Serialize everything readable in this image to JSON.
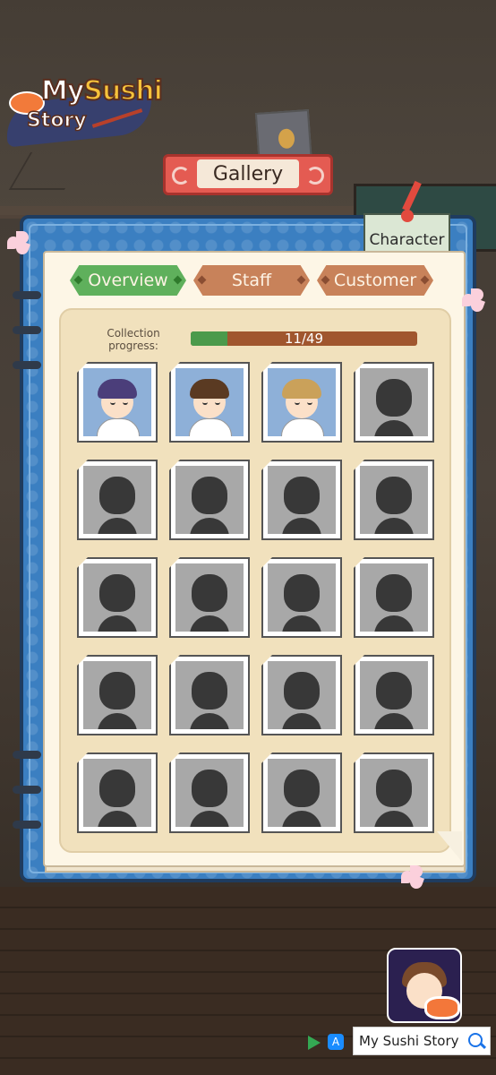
{
  "logo": {
    "line1_a": "My",
    "line1_b": "Sushi",
    "line2": "Story"
  },
  "header": {
    "title": "Gallery"
  },
  "book": {
    "tag_label": "Character"
  },
  "tabs": [
    {
      "label": "Overview",
      "active": true
    },
    {
      "label": "Staff",
      "active": false
    },
    {
      "label": "Customer",
      "active": false
    }
  ],
  "progress": {
    "label": "Collection progress:",
    "text": "11/49",
    "fraction": 0.1633
  },
  "cards": [
    {
      "unlocked": true,
      "character": "chef-bandana"
    },
    {
      "unlocked": true,
      "character": "waitress-bun"
    },
    {
      "unlocked": true,
      "character": "cat-ear-boy"
    },
    {
      "unlocked": false
    },
    {
      "unlocked": false
    },
    {
      "unlocked": false
    },
    {
      "unlocked": false
    },
    {
      "unlocked": false
    },
    {
      "unlocked": false
    },
    {
      "unlocked": false
    },
    {
      "unlocked": false
    },
    {
      "unlocked": false
    },
    {
      "unlocked": false
    },
    {
      "unlocked": false
    },
    {
      "unlocked": false
    },
    {
      "unlocked": false
    },
    {
      "unlocked": false
    },
    {
      "unlocked": false
    },
    {
      "unlocked": false
    },
    {
      "unlocked": false
    }
  ],
  "ad": {
    "search_text": "My Sushi Story",
    "search_icon": "search-icon"
  },
  "colors": {
    "tab_active": "#5fb05c",
    "tab_inactive": "#c8825a",
    "progress_fill": "#4b9a4b",
    "progress_track": "#a0562e",
    "book_blue": "#3b7fc1"
  }
}
